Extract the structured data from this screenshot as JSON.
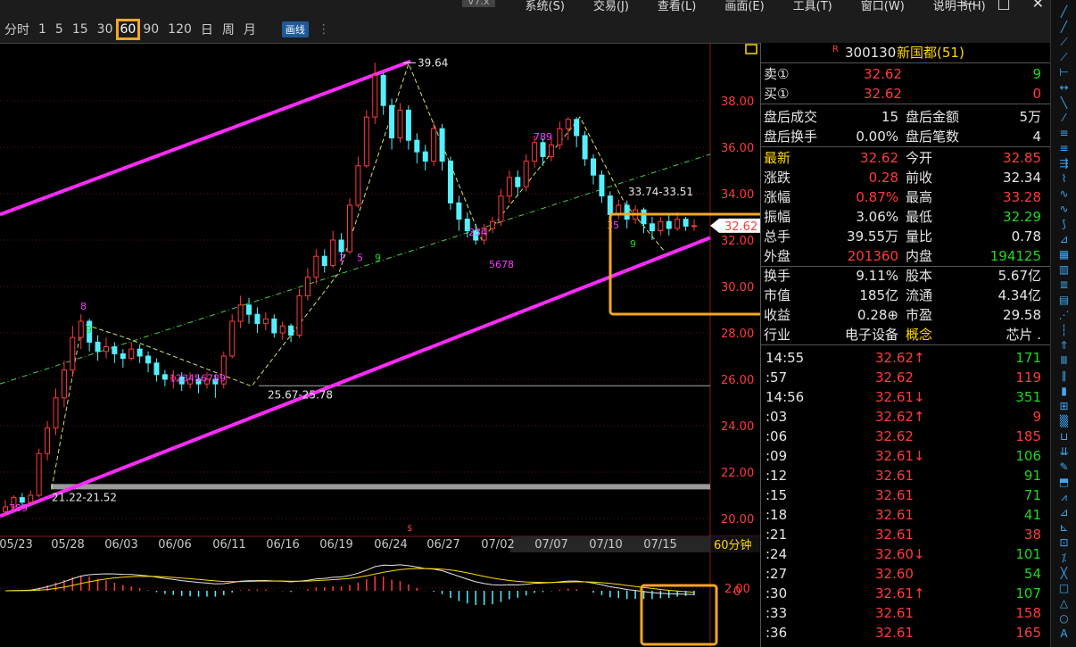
{
  "menu": {
    "version": "V7.x",
    "items": [
      "系统(S)",
      "交易(J)",
      "查看(L)",
      "画面(E)",
      "工具(T)",
      "窗口(W)",
      "说明书(H)"
    ],
    "window_buttons": [
      "—",
      "□",
      "✕"
    ]
  },
  "periods": {
    "items": [
      "分时",
      "1",
      "5",
      "15",
      "30",
      "60",
      "90",
      "120",
      "日",
      "周",
      "月"
    ],
    "selected": "60",
    "draw_label": "画线",
    "dots": "⋮"
  },
  "chart_data": {
    "type": "candlestick",
    "ylim": [
      19.5,
      40.5
    ],
    "y_ticks": [
      "38.00",
      "36.00",
      "34.00",
      "32.00",
      "30.00",
      "28.00",
      "26.00",
      "24.00",
      "22.00",
      "20.00"
    ],
    "x_ticks": [
      "05/23",
      "05/28",
      "06/03",
      "06/06",
      "06/11",
      "06/16",
      "06/19",
      "06/24",
      "06/27",
      "07/02",
      "07/07",
      "07/10",
      "07/15"
    ],
    "period_label": "60分钟",
    "current_price": "32.62",
    "annotations": [
      "39.64",
      "33.74-33.51",
      "25.67-25.78",
      "21.22-21.52"
    ],
    "support_levels": [
      25.72,
      21.37
    ],
    "upper_channel": [
      [
        0,
        33.1
      ],
      [
        460,
        39.7
      ]
    ],
    "lower_channel": [
      [
        0,
        20.1
      ],
      [
        796,
        32.1
      ]
    ],
    "candles": [
      [
        20.3,
        20.5,
        20.1,
        20.8
      ],
      [
        20.5,
        20.9,
        20.3,
        21.0
      ],
      [
        20.9,
        20.7,
        20.5,
        21.1
      ],
      [
        20.7,
        21.0,
        20.6,
        21.2
      ],
      [
        21.0,
        22.8,
        20.9,
        23.0
      ],
      [
        22.8,
        23.9,
        22.5,
        24.2
      ],
      [
        23.9,
        25.2,
        23.6,
        25.6
      ],
      [
        25.2,
        26.4,
        24.8,
        26.8
      ],
      [
        26.4,
        27.8,
        26.1,
        28.3
      ],
      [
        27.8,
        28.5,
        27.3,
        28.8
      ],
      [
        28.5,
        27.6,
        27.2,
        28.6
      ],
      [
        27.6,
        27.2,
        26.8,
        27.9
      ],
      [
        27.2,
        27.4,
        26.9,
        27.8
      ],
      [
        27.4,
        27.1,
        26.7,
        27.6
      ],
      [
        27.1,
        26.9,
        26.5,
        27.3
      ],
      [
        26.9,
        27.3,
        26.8,
        27.6
      ],
      [
        27.3,
        27.0,
        26.7,
        27.5
      ],
      [
        27.0,
        26.7,
        26.3,
        27.2
      ],
      [
        26.7,
        26.2,
        25.9,
        26.9
      ],
      [
        26.2,
        26.0,
        25.7,
        26.4
      ],
      [
        26.0,
        26.1,
        25.6,
        26.4
      ],
      [
        26.1,
        25.8,
        25.5,
        26.3
      ],
      [
        25.8,
        26.0,
        25.6,
        26.3
      ],
      [
        26.0,
        25.8,
        25.4,
        26.2
      ],
      [
        25.8,
        26.0,
        25.6,
        26.3
      ],
      [
        26.0,
        25.8,
        25.2,
        26.2
      ],
      [
        25.8,
        27.0,
        25.6,
        27.2
      ],
      [
        27.0,
        28.5,
        26.9,
        28.8
      ],
      [
        28.5,
        29.2,
        28.2,
        29.6
      ],
      [
        29.2,
        28.8,
        28.4,
        29.5
      ],
      [
        28.8,
        28.4,
        28.0,
        29.1
      ],
      [
        28.4,
        28.6,
        28.1,
        28.9
      ],
      [
        28.6,
        28.0,
        27.8,
        28.8
      ],
      [
        28.0,
        28.3,
        27.7,
        28.5
      ],
      [
        28.3,
        27.9,
        27.6,
        28.4
      ],
      [
        27.9,
        29.6,
        27.8,
        29.9
      ],
      [
        29.6,
        30.4,
        29.4,
        30.8
      ],
      [
        30.4,
        31.3,
        30.1,
        31.6
      ],
      [
        31.3,
        30.9,
        30.6,
        31.6
      ],
      [
        30.9,
        32.0,
        30.8,
        32.4
      ],
      [
        32.0,
        31.5,
        31.1,
        32.3
      ],
      [
        31.5,
        33.5,
        31.4,
        33.8
      ],
      [
        33.5,
        35.2,
        33.4,
        35.6
      ],
      [
        35.2,
        37.3,
        35.1,
        37.6
      ],
      [
        37.3,
        39.1,
        37.0,
        39.64
      ],
      [
        39.1,
        37.8,
        37.4,
        39.2
      ],
      [
        37.8,
        36.4,
        35.9,
        38.1
      ],
      [
        36.4,
        37.6,
        36.2,
        37.9
      ],
      [
        37.6,
        36.3,
        35.9,
        37.8
      ],
      [
        36.3,
        35.8,
        35.3,
        36.6
      ],
      [
        35.8,
        35.4,
        35.0,
        36.1
      ],
      [
        35.4,
        36.8,
        35.2,
        37.1
      ],
      [
        36.8,
        35.4,
        35.0,
        37.0
      ],
      [
        35.4,
        33.6,
        33.3,
        35.6
      ],
      [
        33.6,
        32.9,
        32.4,
        33.9
      ],
      [
        32.9,
        32.4,
        32.1,
        33.2
      ],
      [
        32.4,
        32.0,
        31.8,
        32.7
      ],
      [
        32.0,
        32.5,
        31.8,
        32.7
      ],
      [
        32.5,
        32.8,
        32.3,
        33.0
      ],
      [
        32.8,
        33.9,
        32.6,
        34.2
      ],
      [
        33.9,
        34.7,
        33.6,
        35.0
      ],
      [
        34.7,
        34.3,
        33.9,
        35.0
      ],
      [
        34.3,
        35.4,
        34.1,
        35.7
      ],
      [
        35.4,
        36.2,
        35.1,
        36.5
      ],
      [
        36.2,
        35.6,
        35.2,
        36.4
      ],
      [
        35.6,
        36.1,
        35.4,
        36.4
      ],
      [
        36.1,
        36.8,
        35.9,
        37.1
      ],
      [
        36.8,
        37.2,
        36.3,
        37.3
      ],
      [
        37.2,
        36.5,
        36.0,
        37.3
      ],
      [
        36.5,
        35.5,
        35.2,
        36.7
      ],
      [
        35.5,
        34.8,
        34.4,
        35.7
      ],
      [
        34.8,
        33.9,
        33.6,
        35.0
      ],
      [
        33.9,
        33.1,
        32.8,
        34.1
      ],
      [
        33.1,
        33.5,
        32.9,
        33.74
      ],
      [
        33.5,
        32.9,
        32.5,
        33.7
      ],
      [
        32.9,
        33.3,
        32.7,
        33.5
      ],
      [
        33.3,
        32.7,
        32.3,
        33.4
      ],
      [
        32.7,
        32.4,
        32.0,
        33.0
      ],
      [
        32.4,
        32.8,
        32.2,
        33.0
      ],
      [
        32.8,
        32.5,
        32.2,
        33.1
      ],
      [
        32.5,
        32.9,
        32.4,
        33.2
      ],
      [
        32.9,
        32.6,
        32.4,
        33.0
      ],
      [
        32.6,
        32.62,
        32.4,
        32.9
      ]
    ],
    "macd_label": "2.00",
    "macd_zero_label": "0"
  },
  "quote": {
    "flag": "R",
    "code": "300130",
    "name": "新国都(51)",
    "sell_label": "卖①",
    "sell_price": "32.62",
    "sell_vol": "9",
    "buy_label": "买①",
    "buy_price": "32.62",
    "buy_vol": "0",
    "stats": [
      [
        "盘后成交",
        "15",
        "盘后金额",
        "5万"
      ],
      [
        "盘后换手",
        "0.00%",
        "盘后笔数",
        "4"
      ]
    ],
    "fields": [
      {
        "l1": "最新",
        "v1": "32.62",
        "c1": "red",
        "l2": "今开",
        "v2": "32.85",
        "c2": "red",
        "lc1": "yellow"
      },
      {
        "l1": "涨跌",
        "v1": "0.28",
        "c1": "red",
        "l2": "前收",
        "v2": "32.34",
        "c2": "white"
      },
      {
        "l1": "涨幅",
        "v1": "0.87%",
        "c1": "red",
        "l2": "最高",
        "v2": "33.28",
        "c2": "red"
      },
      {
        "l1": "振幅",
        "v1": "3.06%",
        "c1": "white",
        "l2": "最低",
        "v2": "32.29",
        "c2": "green"
      },
      {
        "l1": "总手",
        "v1": "39.55万",
        "c1": "white",
        "l2": "量比",
        "v2": "0.78",
        "c2": "white"
      },
      {
        "l1": "外盘",
        "v1": "201360",
        "c1": "red",
        "l2": "内盘",
        "v2": "194125",
        "c2": "green"
      },
      {
        "l1": "换手",
        "v1": "9.11%",
        "c1": "white",
        "l2": "股本",
        "v2": "5.67亿",
        "c2": "white"
      },
      {
        "l1": "市值",
        "v1": "185亿",
        "c1": "white",
        "l2": "流通",
        "v2": "4.34亿",
        "c2": "white"
      },
      {
        "l1": "收益",
        "v1": "0.28⊕",
        "c1": "white",
        "l2": "市盈",
        "v2": "29.58",
        "c2": "white"
      },
      {
        "l1": "行业",
        "v1": "电子设备",
        "c1": "white",
        "l2": "概念",
        "v2": "芯片 .",
        "c2": "white",
        "lc2": "yellow"
      }
    ],
    "ticks": [
      {
        "t": "14:55",
        "p": "32.62↑",
        "pc": "red",
        "v": "171",
        "vc": "green"
      },
      {
        "t": ":57",
        "p": "32.62",
        "pc": "red",
        "v": "119",
        "vc": "red"
      },
      {
        "t": "14:56",
        "p": "32.61↓",
        "pc": "red",
        "v": "351",
        "vc": "green"
      },
      {
        "t": ":03",
        "p": "32.62↑",
        "pc": "red",
        "v": "9",
        "vc": "red"
      },
      {
        "t": ":06",
        "p": "32.62",
        "pc": "red",
        "v": "185",
        "vc": "red"
      },
      {
        "t": ":09",
        "p": "32.61↓",
        "pc": "red",
        "v": "106",
        "vc": "green"
      },
      {
        "t": ":12",
        "p": "32.61",
        "pc": "red",
        "v": "91",
        "vc": "green"
      },
      {
        "t": ":15",
        "p": "32.61",
        "pc": "red",
        "v": "71",
        "vc": "green"
      },
      {
        "t": ":18",
        "p": "32.61",
        "pc": "red",
        "v": "41",
        "vc": "green"
      },
      {
        "t": ":21",
        "p": "32.61",
        "pc": "red",
        "v": "38",
        "vc": "red"
      },
      {
        "t": ":24",
        "p": "32.60↓",
        "pc": "red",
        "v": "101",
        "vc": "green"
      },
      {
        "t": ":27",
        "p": "32.60",
        "pc": "red",
        "v": "54",
        "vc": "green"
      },
      {
        "t": ":30",
        "p": "32.61↑",
        "pc": "red",
        "v": "107",
        "vc": "green"
      },
      {
        "t": ":33",
        "p": "32.61",
        "pc": "red",
        "v": "158",
        "vc": "red"
      },
      {
        "t": ":36",
        "p": "32.61",
        "pc": "red",
        "v": "165",
        "vc": "red"
      }
    ]
  }
}
